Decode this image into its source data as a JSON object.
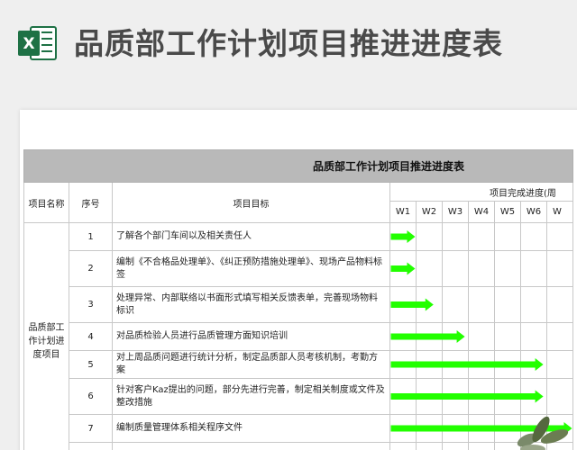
{
  "header": {
    "title": "品质部工作计划项目推进进度表",
    "icon": "excel-icon",
    "icon_letter": "X",
    "icon_color": "#1e7145"
  },
  "sheet": {
    "table_title": "品质部工作计划项目推进进度表",
    "columns": {
      "project_name": "项目名称",
      "seq": "序号",
      "goal": "项目目标",
      "progress": "项目完成进度(周"
    },
    "weeks": [
      "W1",
      "W2",
      "W3",
      "W4",
      "W5",
      "W6",
      "W"
    ],
    "category": "品质部工作计划进度项目",
    "rows": [
      {
        "seq": "1",
        "goal": "了解各个部门车间以及相关责任人",
        "weeks": 1.0
      },
      {
        "seq": "2",
        "goal": "编制《不合格品处理单》、《纠正预防措施处理单》、现场产品物料标签",
        "weeks": 1.0
      },
      {
        "seq": "3",
        "goal": "处理异常、内部联络以书面形式填写相关反馈表单，完善现场物料标识",
        "weeks": 1.7
      },
      {
        "seq": "4",
        "goal": "对品质检验人员进行品质管理方面知识培训",
        "weeks": 2.9
      },
      {
        "seq": "5",
        "goal": "对上周品质问题进行统计分析，制定品质部人员考核机制，考勤方案",
        "weeks": 5.9
      },
      {
        "seq": "6",
        "goal": "针对客户Kaz提出的问题，部分先进行完善，制定相关制度或文件及整改措施",
        "weeks": 5.9
      },
      {
        "seq": "7",
        "goal": "编制质量管理体系相关程序文件",
        "weeks": 7.0
      },
      {
        "seq": "",
        "goal": "",
        "weeks": 0
      }
    ],
    "arrow_color": "#22ff00"
  }
}
